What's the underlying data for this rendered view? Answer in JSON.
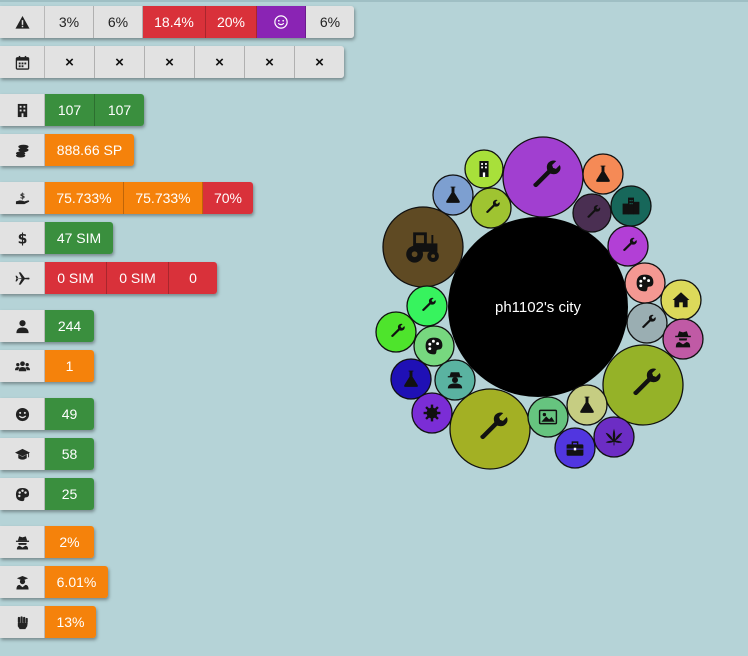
{
  "stats": {
    "hazards": [
      "3%",
      "6%",
      "18.4%",
      "20%",
      "6%"
    ],
    "calendar_marks": [
      "×",
      "×",
      "×",
      "×",
      "×",
      "×"
    ],
    "buildings": [
      "107",
      "107"
    ],
    "sp": "888.66 SP",
    "income": [
      "75.733%",
      "75.733%",
      "70%"
    ],
    "money": "47 SIM",
    "travel": [
      "0 SIM",
      "0 SIM",
      "0"
    ],
    "population": "244",
    "groups": "1",
    "happiness": "49",
    "education": "58",
    "culture": "25",
    "crime": "2%",
    "graduates": "6.01%",
    "protest": "13%"
  },
  "city": {
    "name": "ph1102's city",
    "center_color": "#000000"
  },
  "colors": {
    "green": "#3a8f3e",
    "orange": "#f5820b",
    "red": "#d9313a",
    "purple": "#8a24b4",
    "white": "#e2e2e2",
    "background": "#b5d3d7"
  },
  "bubbles": [
    {
      "icon": "building-icon",
      "color": "#a8e03a"
    },
    {
      "icon": "flask-icon",
      "color": "#7d9fd0"
    },
    {
      "icon": "wrench-icon",
      "color": "#a13fd0"
    },
    {
      "icon": "flask-icon",
      "color": "#f58a56"
    },
    {
      "icon": "wrench-icon",
      "color": "#9fc431"
    },
    {
      "icon": "wrench-icon",
      "color": "#4a2f52"
    },
    {
      "icon": "city-icon",
      "color": "#17675a"
    },
    {
      "icon": "tractor-icon",
      "color": "#5f4a23"
    },
    {
      "icon": "wrench-icon",
      "color": "#b23fd6"
    },
    {
      "icon": "palette-icon",
      "color": "#f49892"
    },
    {
      "icon": "home-icon",
      "color": "#dcd95a"
    },
    {
      "icon": "wrench-icon",
      "color": "#37f35e"
    },
    {
      "icon": "wrench-icon",
      "color": "#9aaeb2"
    },
    {
      "icon": "spy-icon",
      "color": "#c05aa5"
    },
    {
      "icon": "wrench-icon",
      "color": "#4ee42c"
    },
    {
      "icon": "palette-icon",
      "color": "#77d87f"
    },
    {
      "icon": "wrench-icon",
      "color": "#95b228"
    },
    {
      "icon": "flask-icon",
      "color": "#1f10b5"
    },
    {
      "icon": "person-icon",
      "color": "#5ab3a1"
    },
    {
      "icon": "wrench-icon",
      "color": "#a3b024"
    },
    {
      "icon": "image-icon",
      "color": "#66c47f"
    },
    {
      "icon": "flask-icon",
      "color": "#c6cd82"
    },
    {
      "icon": "gear-icon",
      "color": "#7b2dd6"
    },
    {
      "icon": "cannabis-icon",
      "color": "#6c2dc4"
    },
    {
      "icon": "briefcase-icon",
      "color": "#5136e0"
    }
  ]
}
